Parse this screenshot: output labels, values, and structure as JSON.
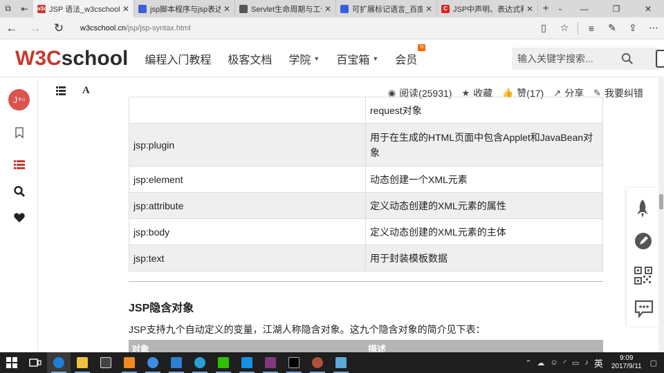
{
  "browser": {
    "tabs": [
      {
        "title": "JSP 语法_w3cschool",
        "favicon_text": "w3c",
        "favicon_color": "#c7382e",
        "active": true
      },
      {
        "title": "jsp脚本程序与jsp表达式_芒",
        "favicon_text": "",
        "favicon_color": "#3b5fd8",
        "active": false
      },
      {
        "title": "Servlet生命周期与工作原理",
        "favicon_text": "",
        "favicon_color": "#555555",
        "active": false
      },
      {
        "title": "可扩展标记语言_百度百科",
        "favicon_text": "",
        "favicon_color": "#3b5fd8",
        "active": false
      },
      {
        "title": "JSP中声明、表达式和脚本",
        "favicon_text": "C",
        "favicon_color": "#d8281e",
        "active": false
      }
    ],
    "url_host": "w3cschool.cn",
    "url_path": "/jsp/jsp-syntax.html"
  },
  "site": {
    "logo_w3": "W3C",
    "logo_school": "school",
    "nav": [
      {
        "label": "编程入门教程",
        "dropdown": false
      },
      {
        "label": "极客文档",
        "dropdown": false
      },
      {
        "label": "学院",
        "dropdown": true
      },
      {
        "label": "百宝箱",
        "dropdown": true
      },
      {
        "label": "会员",
        "dropdown": false,
        "badge": "N"
      }
    ],
    "search_placeholder": "输入关键字搜索...",
    "accent_color": "#c7382e"
  },
  "sidebar": {
    "avatar_letter": "J",
    "avatar_sub": "学习"
  },
  "toolbar": {
    "read": "阅读(25931)",
    "fav": "收藏",
    "like": "赞(17)",
    "share": "分享",
    "report": "我要纠错"
  },
  "content": {
    "rows": [
      {
        "tag": "",
        "desc": "request对象"
      },
      {
        "tag": "jsp:plugin",
        "desc": "用于在生成的HTML页面中包含Applet和JavaBean对象"
      },
      {
        "tag": "jsp:element",
        "desc": "动态创建一个XML元素"
      },
      {
        "tag": "jsp:attribute",
        "desc": "定义动态创建的XML元素的属性"
      },
      {
        "tag": "jsp:body",
        "desc": "定义动态创建的XML元素的主体"
      },
      {
        "tag": "jsp:text",
        "desc": "用于封装模板数据"
      }
    ],
    "heading": "JSP隐含对象",
    "paragraph": "JSP支持九个自动定义的变量，江湖人称隐含对象。这九个隐含对象的简介见下表：",
    "table2_headers": [
      "对象",
      "描述"
    ]
  },
  "taskbar": {
    "ime": "英",
    "time": "9:09",
    "date": "2017/9/11"
  }
}
